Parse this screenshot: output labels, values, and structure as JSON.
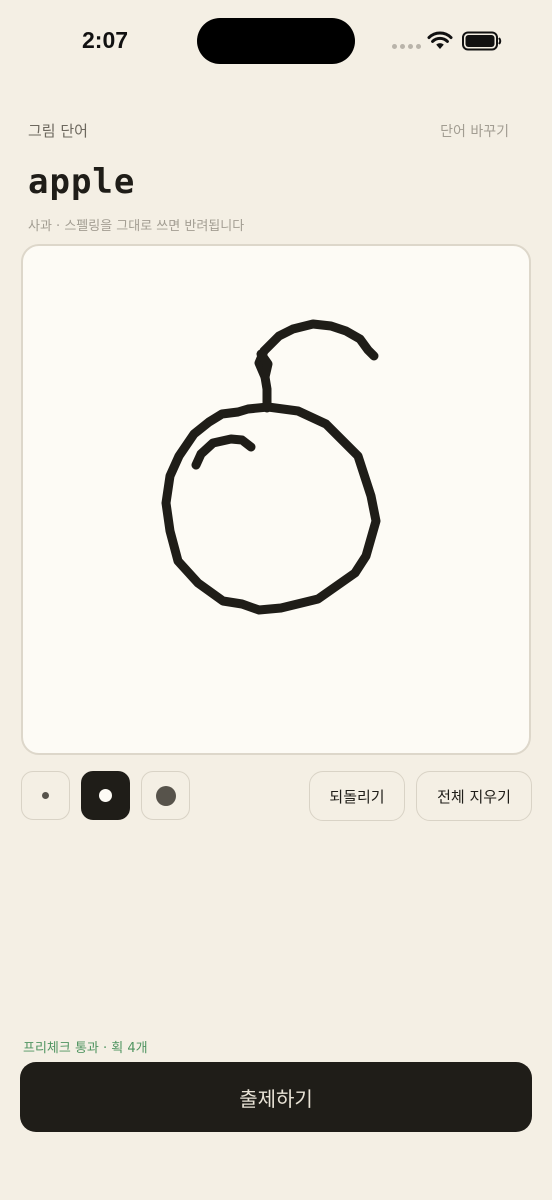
{
  "status_bar": {
    "time": "2:07",
    "wifi_icon": "wifi-icon",
    "battery_icon": "battery-icon"
  },
  "header": {
    "section_label": "그림 단어",
    "change_word_label": "단어 바꾸기"
  },
  "prompt": {
    "word": "apple",
    "hint": "사과 · 스펠링을 그대로 쓰면 반려됩니다"
  },
  "canvas": {
    "drawing": "apple sketch",
    "stroke_color": "#1f1d18",
    "background_color": "#fdfbf5"
  },
  "tools": {
    "brush_sizes": [
      "small",
      "medium",
      "large"
    ],
    "selected_brush": "medium",
    "undo_label": "되돌리기",
    "clear_label": "전체 지우기"
  },
  "footer": {
    "precheck_status": "프리체크 통과 · 획 4개",
    "submit_label": "출제하기",
    "accent_color": "#4f9460"
  }
}
